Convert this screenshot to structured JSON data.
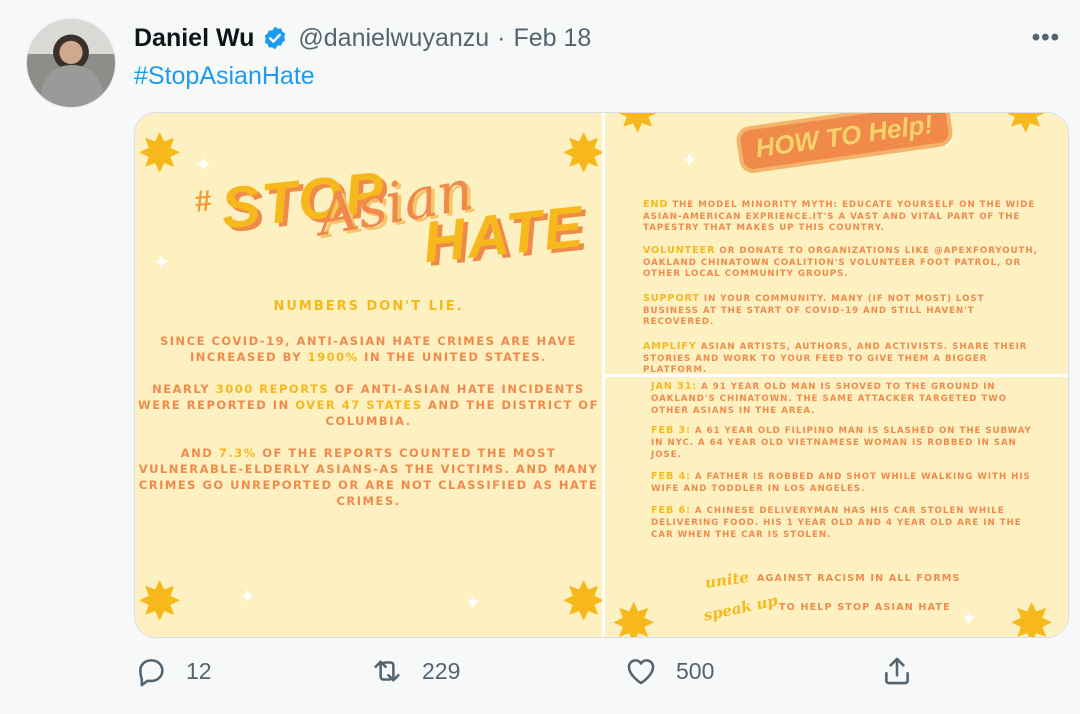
{
  "tweet": {
    "author_name": "Daniel Wu",
    "handle": "@danielwuyanzu",
    "separator": "·",
    "date": "Feb 18",
    "text": "#StopAsianHate",
    "more": "•••"
  },
  "image": {
    "left": {
      "hash": "#",
      "stop": "STOP",
      "asian": "Asian",
      "hate": "HATE",
      "numbers": "NUMBERS DON'T LIE.",
      "para1_a": "SINCE COVID-19, ANTI-ASIAN HATE CRIMES ARE HAVE INCREASED BY ",
      "para1_b": "1900%",
      "para1_c": " IN THE UNITED STATES.",
      "para2_a": "NEARLY ",
      "para2_b": "3000 REPORTS",
      "para2_c": " OF ANTI-ASIAN HATE INCIDENTS WERE REPORTED IN ",
      "para2_d": "OVER 47 STATES",
      "para2_e": " AND THE DISTRICT OF COLUMBIA.",
      "para3_a": "AND ",
      "para3_b": "7.3%",
      "para3_c": " OF THE REPORTS COUNTED THE MOST VULNERABLE-ELDERLY ASIANS-AS THE VICTIMS. AND MANY CRIMES GO UNREPORTED OR ARE NOT CLASSIFIED AS HATE CRIMES."
    },
    "howto": {
      "title": "HOW TO Help!",
      "items": [
        {
          "key": "END",
          "text": " THE MODEL MINORITY MYTH: EDUCATE YOURSELF ON THE WIDE ASIAN-AMERICAN EXPRIENCE.IT'S A VAST AND VITAL PART OF THE TAPESTRY THAT MAKES UP THIS COUNTRY."
        },
        {
          "key": "VOLUNTEER",
          "text": " OR DONATE TO ORGANIZATIONS LIKE @APEXFORYOUTH, OAKLAND CHINATOWN COALITION'S VOLUNTEER FOOT PATROL, OR OTHER LOCAL COMMUNITY GROUPS."
        },
        {
          "key": "SUPPORT",
          "text": " IN YOUR COMMUNITY. MANY (IF NOT MOST) LOST BUSINESS AT THE START OF COVID-19 AND STILL HAVEN'T RECOVERED."
        },
        {
          "key": "AMPLIFY",
          "text": " ASIAN ARTISTS, AUTHORS, AND ACTIVISTS. SHARE THEIR STORIES AND WORK TO YOUR FEED TO GIVE THEM A BIGGER PLATFORM."
        }
      ]
    },
    "events": {
      "items": [
        {
          "key": "JAN 31:",
          "text": " A 91 YEAR OLD MAN IS SHOVED TO THE GROUND IN OAKLAND'S CHINATOWN. THE SAME ATTACKER TARGETED TWO OTHER ASIANS IN THE AREA."
        },
        {
          "key": "FEB 3:",
          "text": " A 61 YEAR OLD FILIPINO MAN IS SLASHED ON THE SUBWAY IN NYC. A 64 YEAR OLD VIETNAMESE WOMAN IS ROBBED IN SAN JOSE."
        },
        {
          "key": "FEB 4:",
          "text": " A FATHER IS ROBBED AND SHOT WHILE WALKING WITH HIS WIFE AND TODDLER IN LOS ANGELES."
        },
        {
          "key": "FEB 6:",
          "text": " A CHINESE DELIVERYMAN HAS HIS CAR STOLEN WHILE DELIVERING FOOD. HIS 1 YEAR OLD AND 4 YEAR OLD ARE IN THE CAR WHEN THE CAR IS STOLEN."
        }
      ],
      "unite_script": "unite",
      "unite_text": "AGAINST RACISM IN ALL FORMS",
      "speak_script": "speak up",
      "speak_text": "TO HELP STOP ASIAN HATE"
    }
  },
  "actions": {
    "replies": "12",
    "retweets": "229",
    "likes": "500"
  },
  "colors": {
    "link": "#1d9bf0",
    "poster_bg": "#fdf1c2",
    "poster_orange": "#f08a4b",
    "poster_yellow": "#f6b81b"
  }
}
